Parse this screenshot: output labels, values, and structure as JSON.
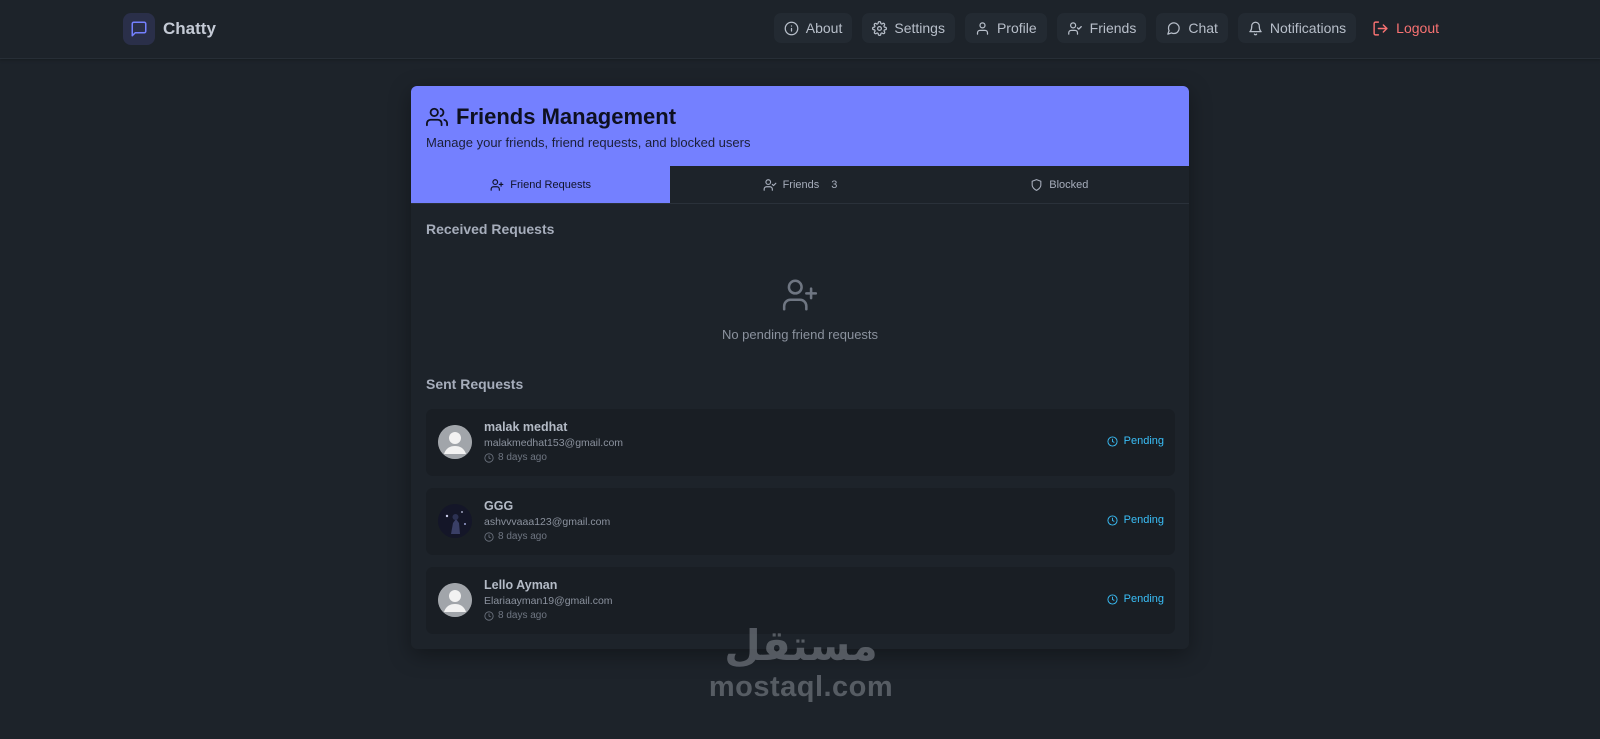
{
  "app": {
    "name": "Chatty",
    "logo_icon": "message-square-icon",
    "accent": "#7480ff"
  },
  "nav": {
    "items": [
      {
        "label": "About",
        "icon": "info-icon"
      },
      {
        "label": "Settings",
        "icon": "gear-icon"
      },
      {
        "label": "Profile",
        "icon": "user-icon"
      },
      {
        "label": "Friends",
        "icon": "user-check-icon"
      },
      {
        "label": "Chat",
        "icon": "message-circle-icon"
      },
      {
        "label": "Notifications",
        "icon": "bell-icon"
      }
    ],
    "logout": {
      "label": "Logout",
      "icon": "logout-icon",
      "color": "#f87272"
    }
  },
  "page": {
    "title": "Friends Management",
    "subtitle": "Manage your friends, friend requests, and blocked users"
  },
  "tabs": [
    {
      "label": "Friend Requests",
      "icon": "user-plus-icon",
      "active": true
    },
    {
      "label": "Friends",
      "icon": "user-check-icon",
      "count": "3"
    },
    {
      "label": "Blocked",
      "icon": "shield-icon"
    }
  ],
  "received": {
    "heading": "Received Requests",
    "empty_icon": "user-plus-icon",
    "empty_text": "No pending friend requests"
  },
  "sent": {
    "heading": "Sent Requests",
    "requests": [
      {
        "name": "malak medhat",
        "email": "malakmedhat153@gmail.com",
        "time": "8 days ago",
        "status": "Pending",
        "avatar": "default-avatar"
      },
      {
        "name": "GGG",
        "email": "ashvvvaaa123@gmail.com",
        "time": "8 days ago",
        "status": "Pending",
        "avatar": "photo-avatar"
      },
      {
        "name": "Lello Ayman",
        "email": "Elariaayman19@gmail.com",
        "time": "8 days ago",
        "status": "Pending",
        "avatar": "default-avatar"
      }
    ]
  },
  "watermark": {
    "arabic": "مستقل",
    "latin": "mostaql.com"
  }
}
